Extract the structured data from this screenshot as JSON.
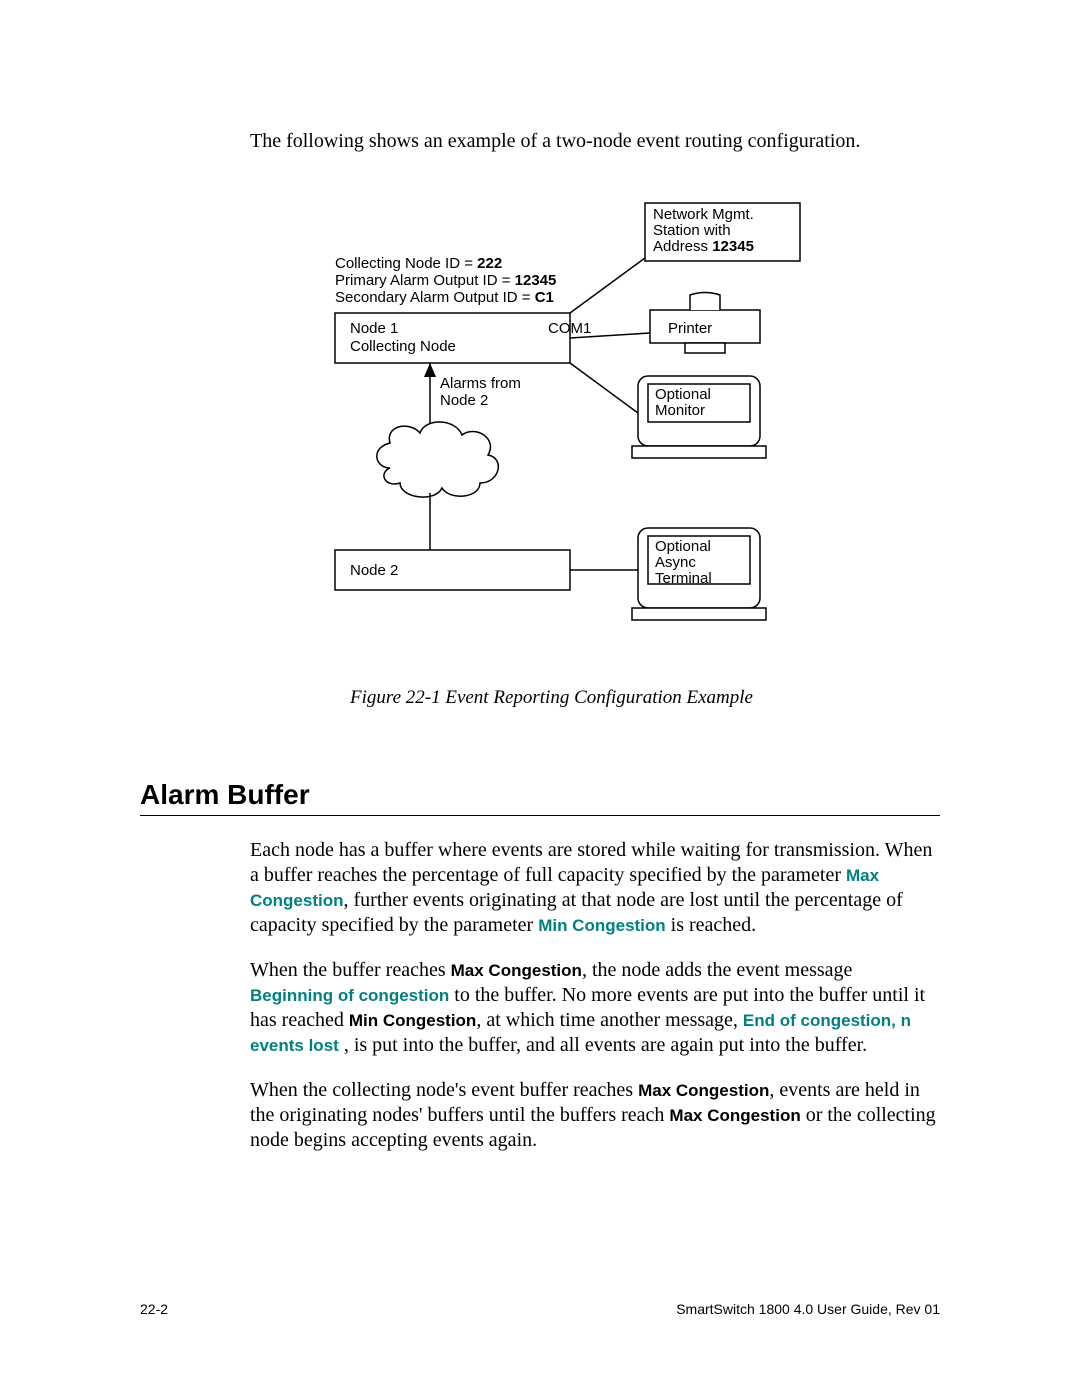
{
  "intro": "The following shows an example of a two-node event routing configuration.",
  "diagram": {
    "nms": {
      "l1": "Network Mgmt.",
      "l2": "Station with",
      "l3": "Address",
      "addr": "12345"
    },
    "config": {
      "l1a": "Collecting Node ID = ",
      "l1b": "222",
      "l2a": "Primary Alarm Output ID = ",
      "l2b": "12345",
      "l3a": "Secondary Alarm Output ID = ",
      "l3b": "C1"
    },
    "node1": {
      "l1": "Node 1",
      "l2": "Collecting Node"
    },
    "com1": "COM1",
    "printer": "Printer",
    "alarms": {
      "l1": "Alarms from",
      "l2": "Node 2"
    },
    "monitor": {
      "l1": "Optional",
      "l2": "Monitor"
    },
    "node2": "Node 2",
    "terminal": {
      "l1": "Optional",
      "l2": "Async",
      "l3": "Terminal"
    }
  },
  "figure_caption": "Figure 22-1    Event Reporting Configuration Example",
  "section_heading": "Alarm Buffer",
  "para1": {
    "t1": "Each node has a buffer where events are stored while waiting for transmission. When a buffer reaches the percentage of full capacity specified by the parameter ",
    "k1": "Max Congestion",
    "t2": ", further events originating at that node are lost until the percentage of capacity specified by the parameter ",
    "k2": "Min Congestion",
    "t3": " is reached."
  },
  "para2": {
    "t1": "When the buffer reaches ",
    "k1": "Max Congestion",
    "t2": ", the node adds the event message ",
    "k2": "Beginning of congestion",
    "t3": " to the buffer. No more events are put into the buffer until it has reached ",
    "k3": "Min Congestion",
    "t4": ", at which time another message, ",
    "k4": "End of congestion, n events lost",
    "t5": " , is put into the buffer, and all events are again put into the buffer."
  },
  "para3": {
    "t1": "When the collecting node's event buffer reaches ",
    "k1": "Max Congestion",
    "t2": ", events are held in the originating nodes' buffers until the buffers reach ",
    "k2": "Max Congestion",
    "t3": " or the collecting node begins accepting events again."
  },
  "footer": {
    "left": "22-2",
    "right": "SmartSwitch 1800 4.0 User Guide, Rev 01"
  }
}
